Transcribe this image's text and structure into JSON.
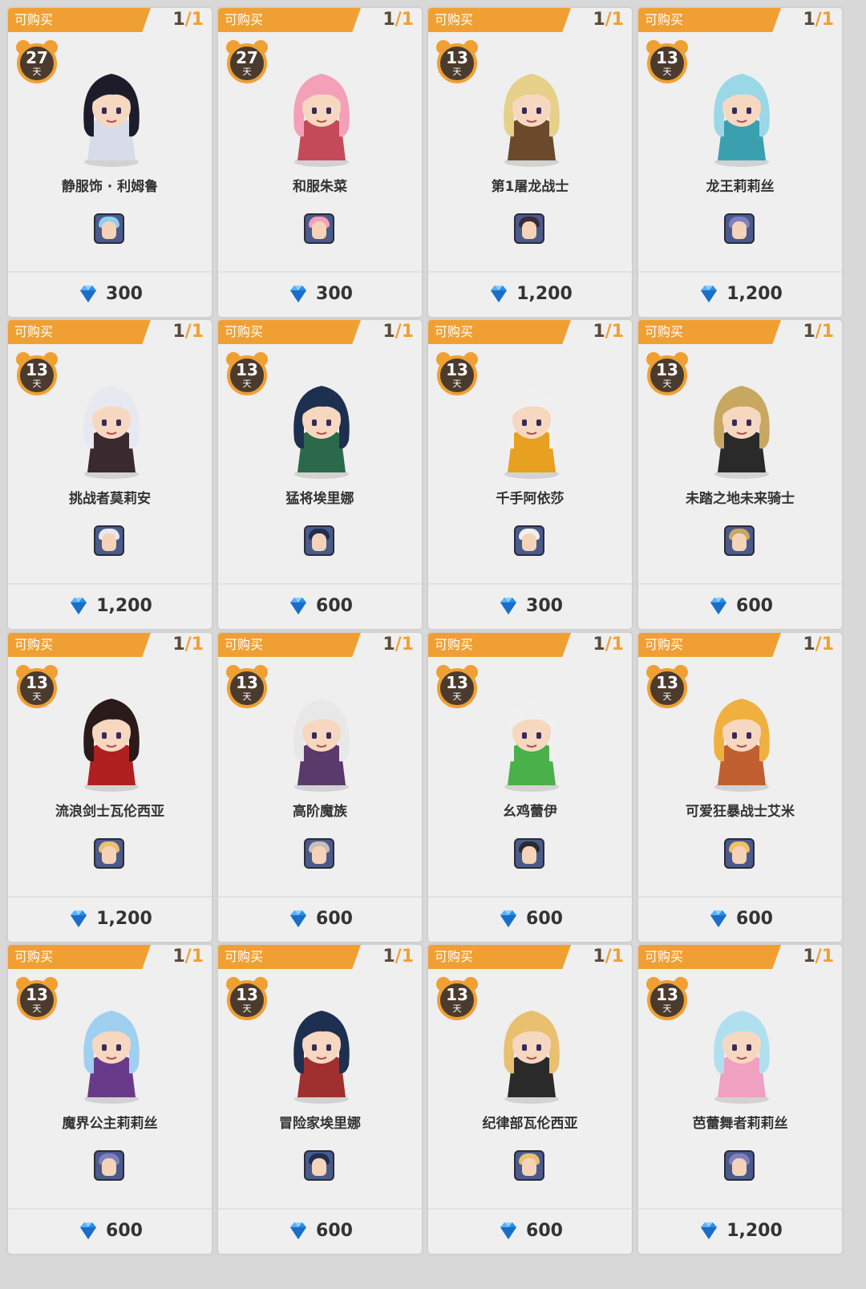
{
  "badge_label": "可购买",
  "day_unit": "天",
  "items": [
    {
      "days": "27",
      "bought": "1",
      "limit": "1",
      "name": "静服饰 · 利姆鲁",
      "price": "300",
      "hair": "#1c1c2a",
      "outfit": "#d8dce8",
      "avatar_hair": "#8fd0f0"
    },
    {
      "days": "27",
      "bought": "1",
      "limit": "1",
      "name": "和服朱菜",
      "price": "300",
      "hair": "#f4a0b8",
      "outfit": "#c44a5a",
      "avatar_hair": "#f4a0b8"
    },
    {
      "days": "13",
      "bought": "1",
      "limit": "1",
      "name": "第1屠龙战士",
      "price": "1,200",
      "hair": "#e6d08a",
      "outfit": "#6a4a2a",
      "avatar_hair": "#3a2a3a"
    },
    {
      "days": "13",
      "bought": "1",
      "limit": "1",
      "name": "龙王莉莉丝",
      "price": "1,200",
      "hair": "#9ad8e8",
      "outfit": "#3aa0b0",
      "avatar_hair": "#8080c0"
    },
    {
      "days": "13",
      "bought": "1",
      "limit": "1",
      "name": "挑战者莫莉安",
      "price": "1,200",
      "hair": "#e8e8f0",
      "outfit": "#3a2a30",
      "avatar_hair": "#e8e8f0"
    },
    {
      "days": "13",
      "bought": "1",
      "limit": "1",
      "name": "猛将埃里娜",
      "price": "600",
      "hair": "#1e3050",
      "outfit": "#2a6a4a",
      "avatar_hair": "#1e3050"
    },
    {
      "days": "13",
      "bought": "1",
      "limit": "1",
      "name": "千手阿依莎",
      "price": "300",
      "hair": "#f0f0f0",
      "outfit": "#e8a020",
      "avatar_hair": "#f0f0f0"
    },
    {
      "days": "13",
      "bought": "1",
      "limit": "1",
      "name": "未踏之地未来骑士",
      "price": "600",
      "hair": "#c8a860",
      "outfit": "#2a2a2a",
      "avatar_hair": "#c8a860"
    },
    {
      "days": "13",
      "bought": "1",
      "limit": "1",
      "name": "流浪剑士瓦伦西亚",
      "price": "1,200",
      "hair": "#2a1a1a",
      "outfit": "#b02020",
      "avatar_hair": "#e8c070"
    },
    {
      "days": "13",
      "bought": "1",
      "limit": "1",
      "name": "高阶魔族",
      "price": "600",
      "hair": "#e8e8e8",
      "outfit": "#5a3a6a",
      "avatar_hair": "#c8c0b8"
    },
    {
      "days": "13",
      "bought": "1",
      "limit": "1",
      "name": "幺鸡蕾伊",
      "price": "600",
      "hair": "#f0f0f0",
      "outfit": "#4ab04a",
      "avatar_hair": "#2a2a2a"
    },
    {
      "days": "13",
      "bought": "1",
      "limit": "1",
      "name": "可爱狂暴战士艾米",
      "price": "600",
      "hair": "#f0b040",
      "outfit": "#c06030",
      "avatar_hair": "#f0c060"
    },
    {
      "days": "13",
      "bought": "1",
      "limit": "1",
      "name": "魔界公主莉莉丝",
      "price": "600",
      "hair": "#a0d0f0",
      "outfit": "#6a3a8a",
      "avatar_hair": "#8080c0"
    },
    {
      "days": "13",
      "bought": "1",
      "limit": "1",
      "name": "冒险家埃里娜",
      "price": "600",
      "hair": "#1e3050",
      "outfit": "#a03030",
      "avatar_hair": "#1e3050"
    },
    {
      "days": "13",
      "bought": "1",
      "limit": "1",
      "name": "纪律部瓦伦西亚",
      "price": "600",
      "hair": "#e8c070",
      "outfit": "#2a2a2a",
      "avatar_hair": "#e8c070"
    },
    {
      "days": "13",
      "bought": "1",
      "limit": "1",
      "name": "芭蕾舞者莉莉丝",
      "price": "1,200",
      "hair": "#b0e0f0",
      "outfit": "#f0a0c0",
      "avatar_hair": "#8080c0"
    }
  ],
  "colors": {
    "accent": "#f0a033",
    "gem": "#2a8ee8",
    "timer_bg": "#4b3b2e"
  },
  "icons": {
    "currency": "diamond-gem-icon",
    "timer": "alarm-clock-icon"
  }
}
